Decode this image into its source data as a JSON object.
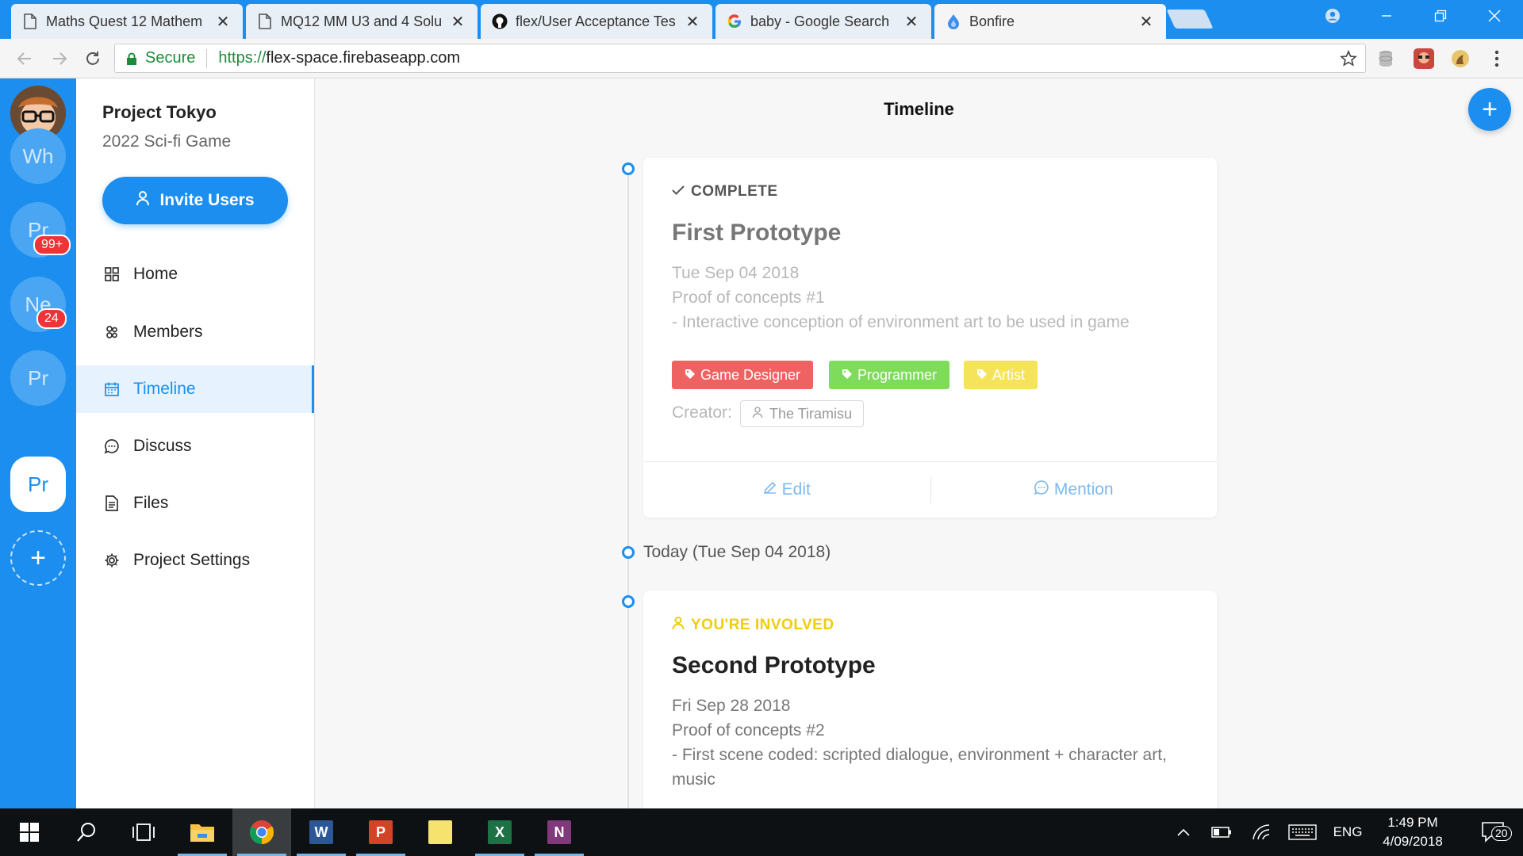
{
  "browser": {
    "tabs": [
      {
        "title": "Maths Quest 12 Mathem",
        "icon": "document-icon"
      },
      {
        "title": "MQ12 MM U3 and 4 Solu",
        "icon": "document-icon"
      },
      {
        "title": "flex/User Acceptance Tes",
        "icon": "github-icon"
      },
      {
        "title": "baby - Google Search",
        "icon": "google-icon"
      },
      {
        "title": "Bonfire",
        "icon": "bonfire-icon"
      }
    ],
    "close_glyph": "✕",
    "secure_label": "Secure",
    "url_scheme": "https://",
    "url_host": "flex-space.firebaseapp.com"
  },
  "workspaces": {
    "items": [
      {
        "initials": "Wh",
        "badge": ""
      },
      {
        "initials": "Pr",
        "badge": "99+"
      },
      {
        "initials": "Ne",
        "badge": "24"
      },
      {
        "initials": "Pr",
        "badge": ""
      },
      {
        "initials": "Pr",
        "badge": "",
        "active": true
      }
    ],
    "add_glyph": "+"
  },
  "sidebar": {
    "project_name": "Project Tokyo",
    "project_subtitle": "2022 Sci-fi Game",
    "invite_label": "Invite Users",
    "nav": [
      {
        "label": "Home",
        "icon": "grid-icon"
      },
      {
        "label": "Members",
        "icon": "members-icon"
      },
      {
        "label": "Timeline",
        "icon": "calendar-icon",
        "active": true
      },
      {
        "label": "Discuss",
        "icon": "chat-icon"
      },
      {
        "label": "Files",
        "icon": "file-icon"
      },
      {
        "label": "Project Settings",
        "icon": "gear-icon"
      }
    ]
  },
  "main": {
    "title": "Timeline",
    "fab_glyph": "+",
    "cards": [
      {
        "status": "COMPLETE",
        "status_color": "#555555",
        "title": "First Prototype",
        "title_color": "#777777",
        "date": "Tue Sep 04 2018",
        "description_line1": "Proof of concepts #1",
        "description_line2": "- Interactive conception of environment art to be used in game",
        "tags": [
          {
            "label": "Game Designer",
            "color": "#ef6262"
          },
          {
            "label": "Programmer",
            "color": "#7fdb5a"
          },
          {
            "label": "Artist",
            "color": "#f5e35a"
          }
        ],
        "creator_label": "Creator:",
        "creator_name": "The Tiramisu",
        "edit_label": "Edit",
        "mention_label": "Mention"
      },
      {
        "status": "YOU'RE INVOLVED",
        "status_color": "#f0cc10",
        "title": "Second Prototype",
        "title_color": "#222222",
        "date": "Fri Sep 28 2018",
        "description_line1": "Proof of concepts #2",
        "description_line2": "- First scene coded: scripted dialogue, environment + character art, music"
      }
    ],
    "today_label": "Today (Tue Sep 04 2018)"
  },
  "taskbar": {
    "time": "1:49 PM",
    "date": "4/09/2018",
    "language": "ENG",
    "notification_count": "20",
    "apps": [
      "windows-start-icon",
      "search-icon",
      "task-view-icon",
      "file-explorer-icon",
      "chrome-icon",
      "word-icon",
      "powerpoint-icon",
      "sticky-notes-icon",
      "excel-icon",
      "onenote-icon"
    ]
  },
  "colors": {
    "brand": "#1b8ef0",
    "active_bg": "#e6f3fe",
    "badge": "#ee3437"
  }
}
